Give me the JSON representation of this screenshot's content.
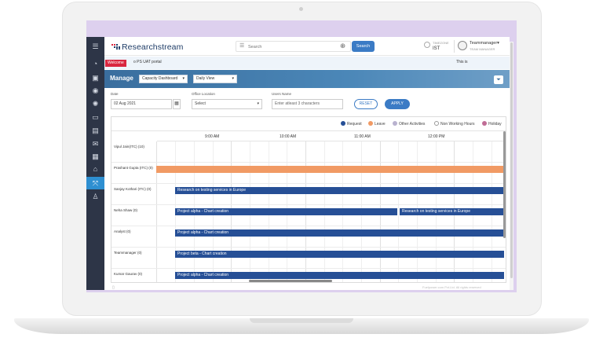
{
  "brand": {
    "name": "Researchstream"
  },
  "header": {
    "search_placeholder": "Search",
    "search_button": "Search",
    "timezone_label": "TIMEZONE",
    "timezone_value": "IST",
    "user_name": "Teammanager",
    "user_role": "TEAM MANAGER"
  },
  "welcome": {
    "badge": "Welcome",
    "text": "o PS UAT portal",
    "right_text": "This is"
  },
  "manage": {
    "title": "Manage",
    "dashboard_select": "Capacity Dashboard",
    "view_select": "Daily View"
  },
  "filters": {
    "date_label": "Date",
    "date_value": "02 Aug 2021",
    "office_label": "Office Location",
    "office_value": "Select",
    "users_label": "Users Name",
    "users_placeholder": "Enter atleast 3 characters",
    "reset_label": "RESET",
    "apply_label": "APPLY"
  },
  "legend": [
    {
      "label": "Request",
      "color": "#264f96"
    },
    {
      "label": "Leave",
      "color": "#f19a64"
    },
    {
      "label": "Other Activities",
      "color": "#b9b2cf"
    },
    {
      "label": "Non Working Hours",
      "color": "#ffffff"
    },
    {
      "label": "Holiday",
      "color": "#c06d96"
    }
  ],
  "times": [
    "9:00 AM",
    "10:00 AM",
    "11:00 AM",
    "12:00 PM"
  ],
  "rows": [
    {
      "name": "Vipul Jain(ITC) (10)",
      "bars": []
    },
    {
      "name": "Prashant Gupta (ITC) (0)",
      "bars": [
        {
          "label": "",
          "type": "leave"
        }
      ]
    },
    {
      "name": "Sanjay Kothari (ITC) (0)",
      "bars": [
        {
          "label": "Research on testing services in Europe",
          "type": "request"
        }
      ]
    },
    {
      "name": "Neha Shaw (0)",
      "bars": [
        {
          "label": "Project alpha - Chart creation",
          "type": "request"
        },
        {
          "label": "Research on testing services in Europe",
          "type": "request"
        }
      ]
    },
    {
      "name": "Analyst (0)",
      "bars": [
        {
          "label": "Project alpha - Chart creation",
          "type": "request"
        }
      ]
    },
    {
      "name": "Teammanager (0)",
      "bars": [
        {
          "label": "Project beta - Chart creation",
          "type": "request"
        }
      ]
    },
    {
      "name": "Kumar Gaurav (0)",
      "bars": [
        {
          "label": "Project alpha - Chart creation",
          "type": "request"
        }
      ]
    }
  ],
  "footer": {
    "text": "Fuelpower.com Pvt.Ltd. All rights reserved"
  },
  "sidebar_icons": [
    "menu-icon",
    "speedometer-icon",
    "save-icon",
    "eye-icon",
    "bulb-icon",
    "chat-icon",
    "report-icon",
    "mail-icon",
    "document-icon",
    "inbox-icon",
    "capacity-icon",
    "user-lock-icon"
  ]
}
